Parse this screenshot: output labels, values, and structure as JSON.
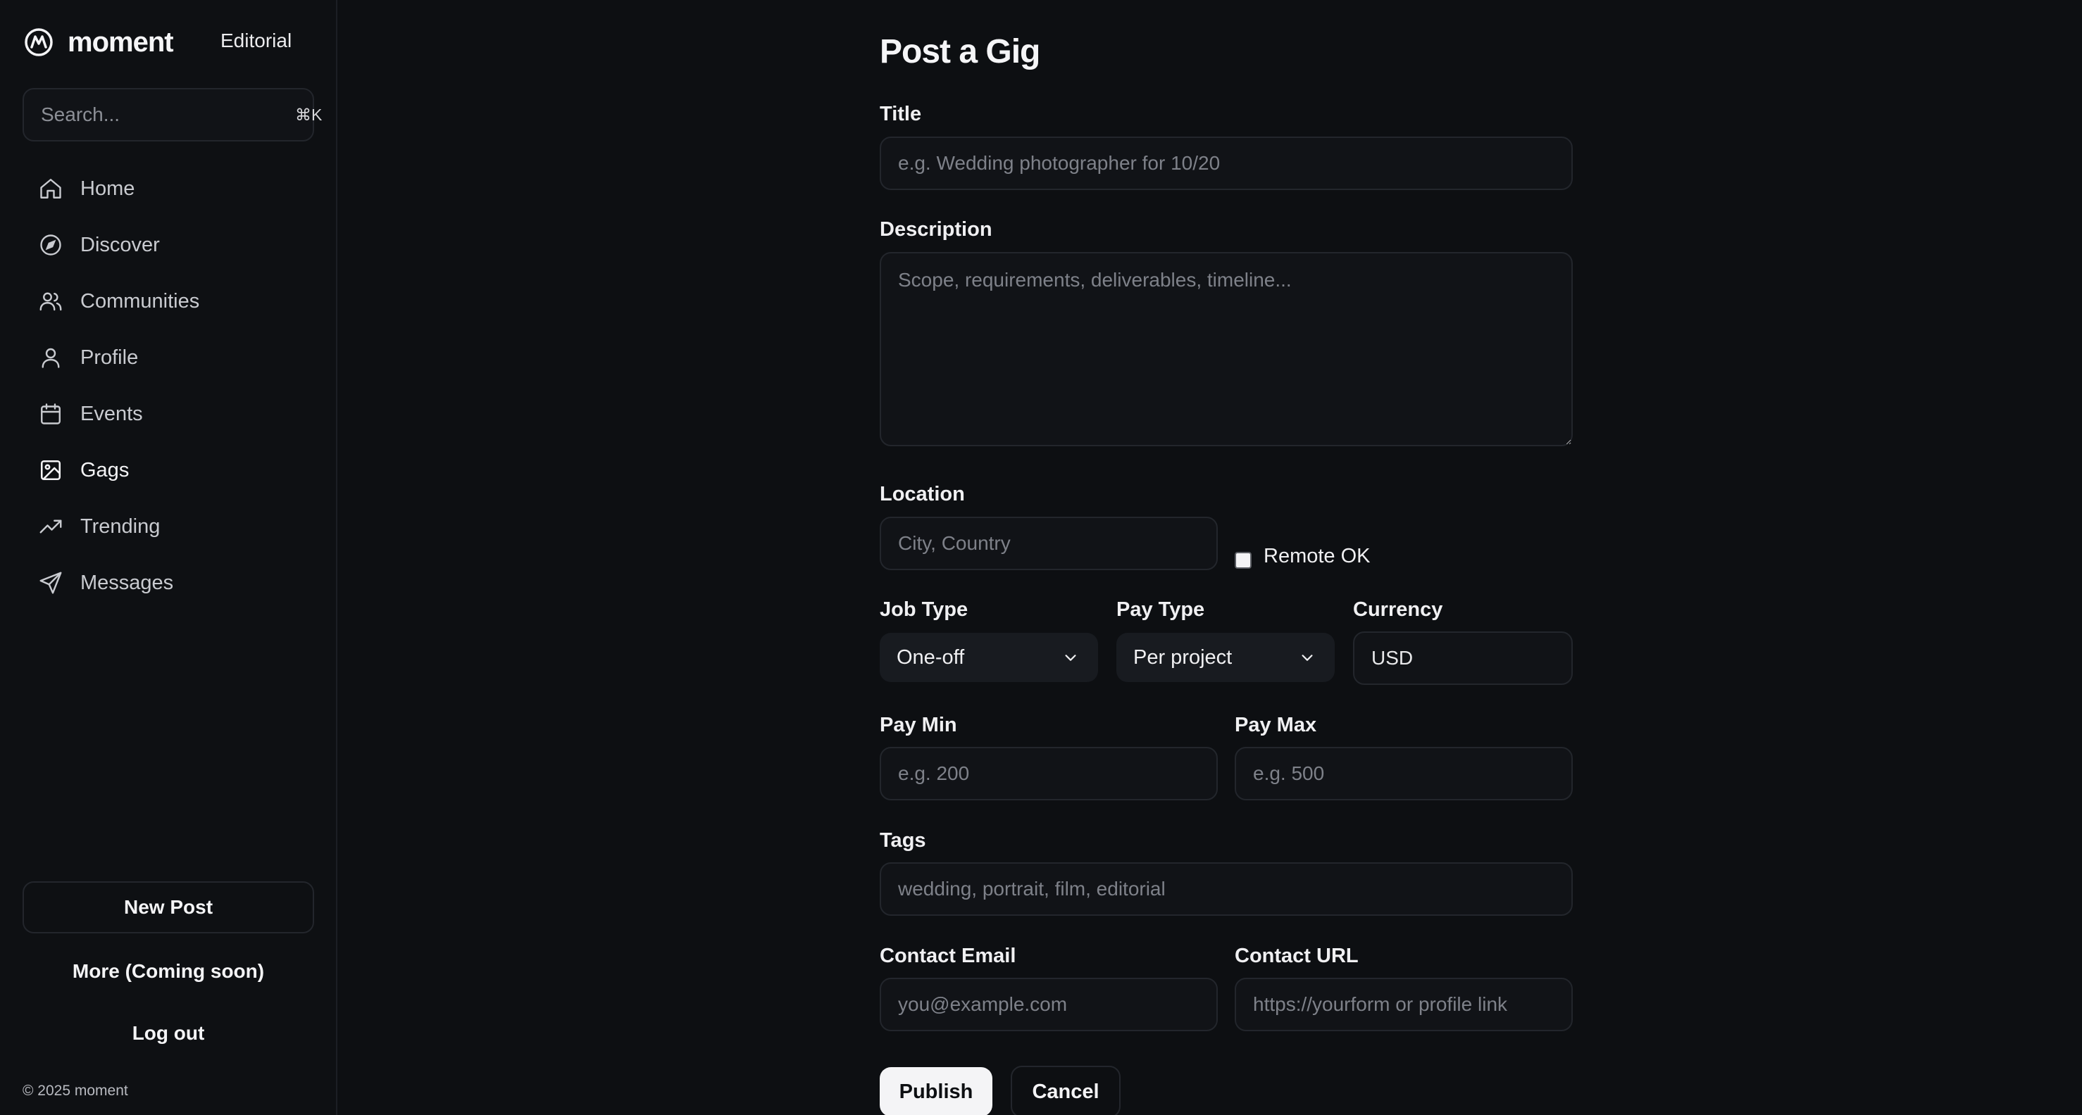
{
  "app": {
    "brand": "moment",
    "brand_sub": "Editorial",
    "logo_icon": "moment-logo-icon"
  },
  "sidebar": {
    "search": {
      "placeholder": "Search...",
      "shortcut": "⌘K"
    },
    "items": [
      {
        "label": "Home",
        "icon": "home-icon",
        "active": false
      },
      {
        "label": "Discover",
        "icon": "compass-icon",
        "active": false
      },
      {
        "label": "Communities",
        "icon": "users-icon",
        "active": false
      },
      {
        "label": "Profile",
        "icon": "user-icon",
        "active": false
      },
      {
        "label": "Events",
        "icon": "calendar-icon",
        "active": false
      },
      {
        "label": "Gags",
        "icon": "image-icon",
        "active": true
      },
      {
        "label": "Trending",
        "icon": "trending-icon",
        "active": false
      },
      {
        "label": "Messages",
        "icon": "send-icon",
        "active": false
      }
    ],
    "new_post": "New Post",
    "more": "More (Coming soon)",
    "logout": "Log out",
    "copyright": "© 2025 moment"
  },
  "form": {
    "title": "Post a Gig",
    "fields": {
      "title": {
        "label": "Title",
        "placeholder": "e.g. Wedding photographer for 10/20",
        "value": ""
      },
      "description": {
        "label": "Description",
        "placeholder": "Scope, requirements, deliverables, timeline...",
        "value": ""
      },
      "location": {
        "label": "Location",
        "placeholder": "City, Country",
        "value": ""
      },
      "remote": {
        "label": "Remote OK",
        "checked": false
      },
      "job_type": {
        "label": "Job Type",
        "value": "One-off"
      },
      "pay_type": {
        "label": "Pay Type",
        "value": "Per project"
      },
      "currency": {
        "label": "Currency",
        "value": "USD"
      },
      "pay_min": {
        "label": "Pay Min",
        "placeholder": "e.g. 200",
        "value": ""
      },
      "pay_max": {
        "label": "Pay Max",
        "placeholder": "e.g. 500",
        "value": ""
      },
      "tags": {
        "label": "Tags",
        "placeholder": "wedding, portrait, film, editorial",
        "value": ""
      },
      "contact_email": {
        "label": "Contact Email",
        "placeholder": "you@example.com",
        "value": ""
      },
      "contact_url": {
        "label": "Contact URL",
        "placeholder": "https://yourform or profile link",
        "value": ""
      }
    },
    "publish": "Publish",
    "cancel": "Cancel"
  },
  "colors": {
    "background": "#0d0f12",
    "border": "#23262c",
    "text": "#f0f0f2",
    "placeholder": "#7e8189",
    "primary_button": "#f4f4f6"
  }
}
